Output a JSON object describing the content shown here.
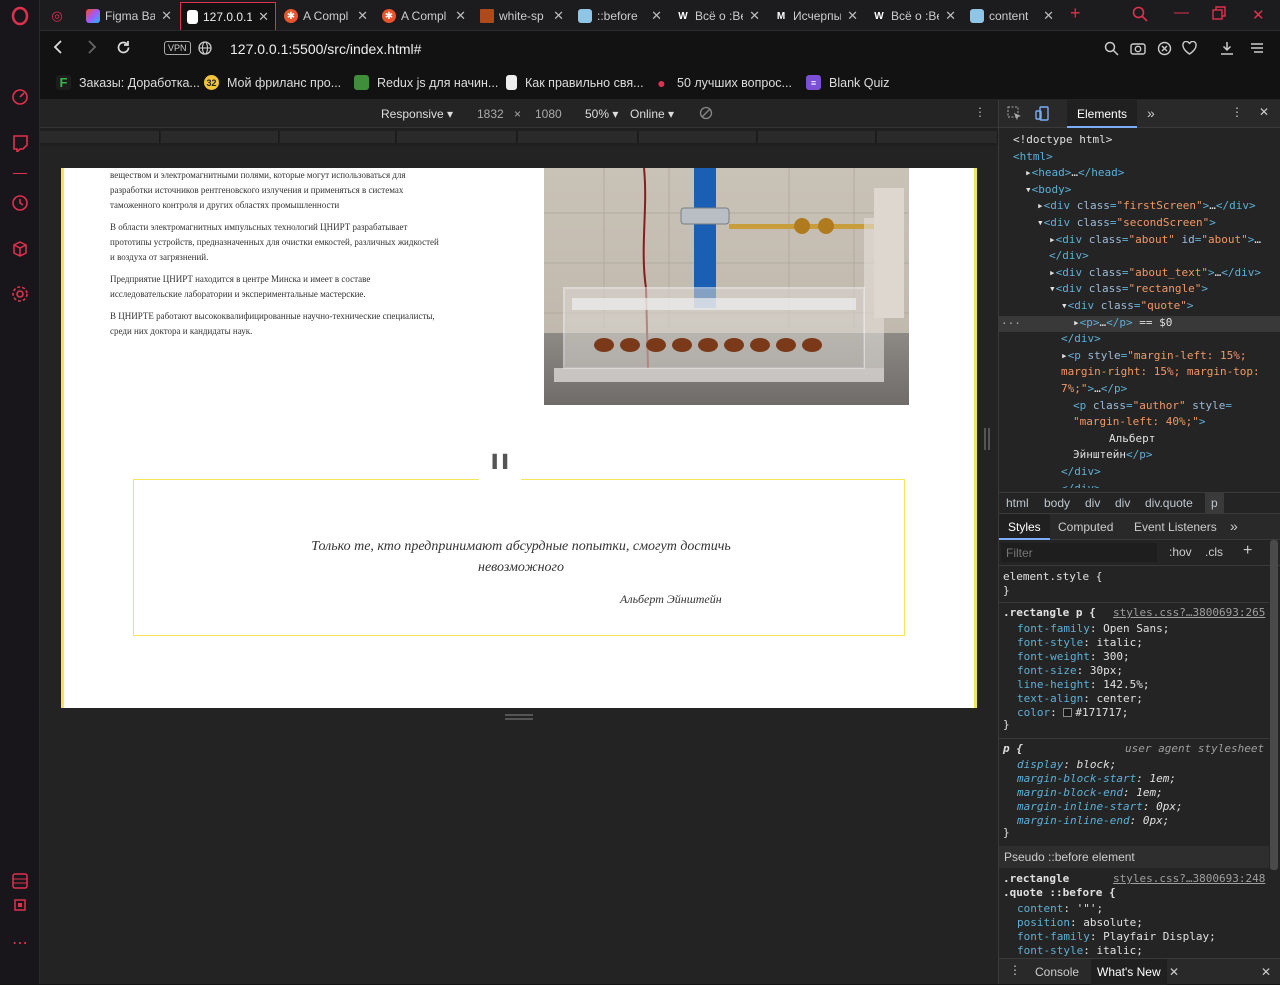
{
  "tabs": [
    {
      "label": "",
      "icon": "gamepad-icon"
    },
    {
      "label": "Figma Ba"
    },
    {
      "label": "127.0.0.1"
    },
    {
      "label": "A Compl"
    },
    {
      "label": "A Compl"
    },
    {
      "label": "white-sp"
    },
    {
      "label": "::before"
    },
    {
      "label": "Всё о :Ве"
    },
    {
      "label": "Исчерпы"
    },
    {
      "label": "Всё о :Ве"
    },
    {
      "label": "content"
    }
  ],
  "address": {
    "vpn": "VPN",
    "url": "127.0.0.1:5500/src/index.html#"
  },
  "bookmarks": [
    {
      "label": "Заказы: Доработка..."
    },
    {
      "label": "Мой фриланс про...",
      "badge": "32"
    },
    {
      "label": "Redux js для начин..."
    },
    {
      "label": "Как правильно свя..."
    },
    {
      "label": "50 лучших вопрос..."
    },
    {
      "label": "Blank Quiz"
    }
  ],
  "device_toolbar": {
    "mode": "Responsive",
    "width": "1832",
    "times": "×",
    "height": "1080",
    "zoom": "50%",
    "network": "Online"
  },
  "page": {
    "paragraphs": [
      "веществом и электромагнитными полями, которые могут использоваться для разработки источников рентгеновского излучения и применяться в системах таможенного контроля и других областях промышленности",
      "В области электромагнитных импульсных технологий ЦНИРТ разрабатывает прототипы устройств, предназначенных для очистки емкостей, различных жидкостей и воздуха от загрязнений.",
      "Предприятие ЦНИРТ находится в центре Минска и имеет в составе исследовательские лаборатории и экспериментальные мастерские.",
      "В ЦНИРТЕ работают высококвалифицированные научно-технические специалисты, среди них доктора и кандидаты наук."
    ],
    "quote_mark": "\"",
    "quote": "Только те, кто предпринимают абсурдные попытки, смогут достичь невозможного",
    "author": "Альберт Эйнштейн"
  },
  "devtools": {
    "tab_elements": "Elements",
    "more": "»",
    "tree": [
      {
        "indent": 0,
        "html": "<span class='txt'>&lt;!doctype html&gt;</span>"
      },
      {
        "indent": 0,
        "html": "<span class='tag'>&lt;html&gt;</span>"
      },
      {
        "indent": 1,
        "html": "<span class='txt'>▸</span><span class='tag'>&lt;head&gt;</span><span class='txt'>…</span><span class='tag'>&lt;/head&gt;</span>"
      },
      {
        "indent": 1,
        "html": "<span class='txt'>▾</span><span class='tag'>&lt;body&gt;</span>"
      },
      {
        "indent": 2,
        "html": "<span class='txt'>▸</span><span class='tag'>&lt;div </span><span class='attr'>class</span><span class='tag'>=</span><span class='val'>\"firstScreen\"</span><span class='tag'>&gt;</span><span class='txt'>…</span><span class='tag'>&lt;/div&gt;</span>"
      },
      {
        "indent": 2,
        "html": "<span class='txt'>▾</span><span class='tag'>&lt;div </span><span class='attr'>class</span><span class='tag'>=</span><span class='val'>\"secondScreen\"</span><span class='tag'>&gt;</span>"
      },
      {
        "indent": 3,
        "html": "<span class='txt'>▸</span><span class='tag'>&lt;div </span><span class='attr'>class</span><span class='tag'>=</span><span class='val'>\"about\"</span><span class='attr'> id</span><span class='tag'>=</span><span class='val'>\"about\"</span><span class='tag'>&gt;</span><span class='txt'>…</span>"
      },
      {
        "indent": 3,
        "html": "<span class='tag'>&lt;/div&gt;</span>"
      },
      {
        "indent": 3,
        "html": "<span class='txt'>▸</span><span class='tag'>&lt;div </span><span class='attr'>class</span><span class='tag'>=</span><span class='val'>\"about_text\"</span><span class='tag'>&gt;</span><span class='txt'>…</span><span class='tag'>&lt;/div&gt;</span>"
      },
      {
        "indent": 3,
        "html": "<span class='txt'>▾</span><span class='tag'>&lt;div </span><span class='attr'>class</span><span class='tag'>=</span><span class='val'>\"rectangle\"</span><span class='tag'>&gt;</span>"
      },
      {
        "indent": 4,
        "html": "<span class='txt'>▾</span><span class='tag'>&lt;div </span><span class='attr'>class</span><span class='tag'>=</span><span class='val'>\"quote\"</span><span class='tag'>&gt;</span>"
      },
      {
        "indent": 5,
        "html": "<span class='txt'>▸</span><span class='tag'>&lt;p&gt;</span><span class='txt'>…</span><span class='tag'>&lt;/p&gt;</span><span class='txt'> == $0</span>"
      },
      {
        "indent": 4,
        "html": "<span class='tag'>&lt;/div&gt;</span>"
      },
      {
        "indent": 4,
        "html": "<span class='txt'>▸</span><span class='tag'>&lt;p </span><span class='attr'>style</span><span class='tag'>=</span><span class='val'>\"margin-left: 15%;</span>"
      },
      {
        "indent": 4,
        "html": "<span class='val'>margin-right: 15%; margin-top:</span>"
      },
      {
        "indent": 4,
        "html": "<span class='val'>7%;\"</span><span class='tag'>&gt;</span><span class='txt'>…</span><span class='tag'>&lt;/p&gt;</span>"
      },
      {
        "indent": 5,
        "html": "<span class='tag'>&lt;p </span><span class='attr'>class</span><span class='tag'>=</span><span class='val'>\"author\"</span><span class='attr'> style</span><span class='tag'>=</span>"
      },
      {
        "indent": 5,
        "html": "<span class='val'>\"margin-left: 40%;\"</span><span class='tag'>&gt;</span>"
      },
      {
        "indent": 8,
        "html": "<span class='txt'>Альберт</span>"
      },
      {
        "indent": 5,
        "html": "<span class='txt'>Эйнштейн</span><span class='tag'>&lt;/p&gt;</span>"
      },
      {
        "indent": 4,
        "html": "<span class='tag'>&lt;/div&gt;</span>"
      },
      {
        "indent": 4,
        "html": "<span class='tag'>&lt;/div&gt;</span>"
      }
    ],
    "crumbs": [
      "html",
      "body",
      "div",
      "div",
      "div.quote",
      "p"
    ],
    "styles_tabs": [
      "Styles",
      "Computed",
      "Event Listeners",
      "»"
    ],
    "filter_placeholder": "Filter",
    "hov": ":hov",
    "cls": ".cls",
    "plus": "+",
    "element_style": "element.style {",
    "close_brace": "}",
    "rule1_selector": ".rectangle p {",
    "rule1_link": "styles.css?…3800693:265",
    "rule1_props": [
      [
        "font-family",
        "Open Sans;"
      ],
      [
        "font-style",
        "italic;"
      ],
      [
        "font-weight",
        "300;"
      ],
      [
        "font-size",
        "30px;"
      ],
      [
        "line-height",
        "142.5%;"
      ],
      [
        "text-align",
        "center;"
      ],
      [
        "color",
        "#171717;"
      ]
    ],
    "ua_selector": "p {",
    "ua_label": "user agent stylesheet",
    "ua_props": [
      [
        "display",
        "block;"
      ],
      [
        "margin-block-start",
        "1em;"
      ],
      [
        "margin-block-end",
        "1em;"
      ],
      [
        "margin-inline-start",
        "0px;"
      ],
      [
        "margin-inline-end",
        "0px;"
      ]
    ],
    "pseudo_head": "Pseudo ::before element",
    "rule2_selector_a": ".rectangle",
    "rule2_selector_b": ".quote ::before {",
    "rule2_link": "styles.css?…3800693:248",
    "rule2_props": [
      [
        "content",
        "'\"';"
      ],
      [
        "position",
        "absolute;"
      ],
      [
        "font-family",
        "Playfair Display;"
      ],
      [
        "font-style",
        "italic;"
      ]
    ],
    "console_tabs": [
      "Console",
      "What's New"
    ]
  }
}
